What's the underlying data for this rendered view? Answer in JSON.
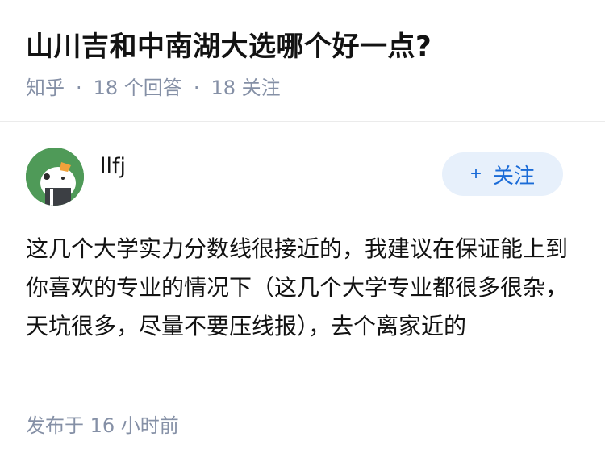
{
  "question": {
    "title": "山川吉和中南湖大选哪个好一点?",
    "source": "知乎",
    "separator": "·",
    "answer_count": "18 个回答",
    "follow_count": "18 关注"
  },
  "answer": {
    "author_name": "llfj",
    "follow_button": {
      "plus": "+",
      "label": "关注"
    },
    "content": "这几个大学实力分数线很接近的，我建议在保证能上到你喜欢的专业的情况下（这几个大学专业都很多很杂，天坑很多，尽量不要压线报），去个离家近的",
    "timestamp": "发布于 16 小时前"
  },
  "colors": {
    "accent": "#1a6bd7",
    "accent_bg": "#e7f0fb",
    "meta_text": "#8590a6",
    "avatar_bg": "#4f9a58"
  }
}
